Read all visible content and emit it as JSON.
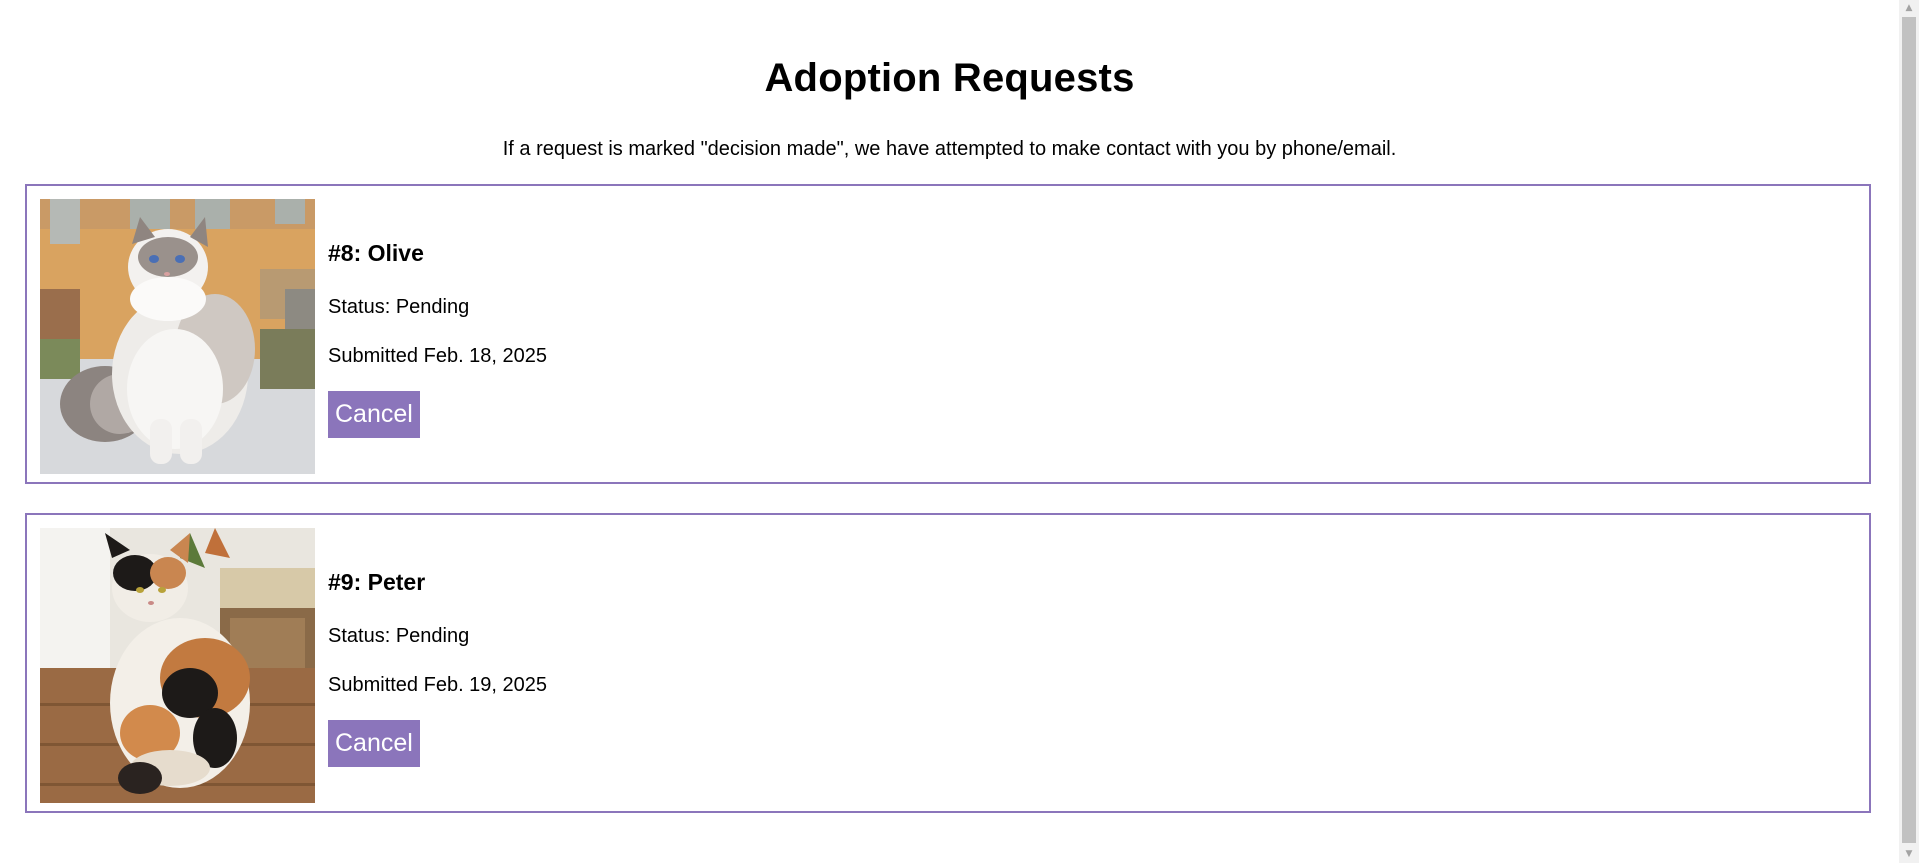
{
  "page": {
    "title": "Adoption Requests",
    "subtitle": "If a request is marked \"decision made\", we have attempted to make contact with you by phone/email."
  },
  "requests": [
    {
      "heading": "#8: Olive",
      "status": "Status: Pending",
      "submitted": "Submitted Feb. 18, 2025",
      "cancel_label": "Cancel",
      "photo_icon": "cat-photo-white-fluffy"
    },
    {
      "heading": "#9: Peter",
      "status": "Status: Pending",
      "submitted": "Submitted Feb. 19, 2025",
      "cancel_label": "Cancel",
      "photo_icon": "cat-photo-calico"
    }
  ],
  "colors": {
    "accent": "#8b75bb",
    "button_text": "#ffffff"
  }
}
